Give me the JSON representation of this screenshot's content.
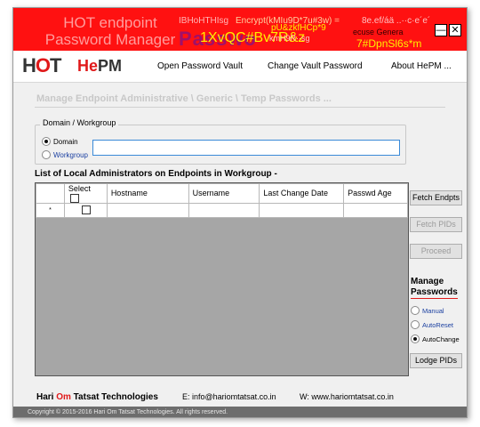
{
  "title": {
    "line1": "HOT endpoint",
    "line2": "Password Manager",
    "deco": [
      "IBHoHTHIsg",
      "Encrypt(kMIu9D*7u#3w) =",
      "8e.ef/áä ..··c·e´e´",
      "Passwo",
      "1XvQC#Bv7R&z",
      "pU&zkfHCp*9",
      "kmH9R··sg",
      "ecuse Genera",
      "7#DpnSl6s*m"
    ],
    "minimize": "—",
    "close": "✕"
  },
  "brand": {
    "logo_h": "H",
    "logo_o": "O",
    "logo_t": "T",
    "product_h": "He",
    "product_rest": "PM"
  },
  "menu": {
    "items": [
      "Open Password Vault",
      "Change Vault Password",
      "About HePM ..."
    ]
  },
  "subtitle": "Manage Endpoint Administrative \\ Generic \\ Temp Passwords ...",
  "domain_group": {
    "legend": "Domain / Workgroup",
    "options": [
      "Domain",
      "Workgroup"
    ],
    "selected": "Domain",
    "input_value": ""
  },
  "list": {
    "title": "List of Local Administrators on Endpoints in Workgroup -",
    "columns": [
      "Select",
      "Hostname",
      "Username",
      "Last Change Date",
      "Passwd Age"
    ],
    "row_marker": "*"
  },
  "buttons": {
    "fetch_endpts": "Fetch Endpts",
    "fetch_pids": "Fetch PIDs",
    "proceed": "Proceed",
    "lodge_pids": "Lodge PIDs"
  },
  "manage": {
    "title_line1": "Manage",
    "title_line2": "Passwords",
    "options": [
      "Manual",
      "AutoReset",
      "AutoChange"
    ],
    "selected": "AutoChange"
  },
  "footer": {
    "company_a": "Hari ",
    "company_om": "Om",
    "company_b": " Tatsat Technologies",
    "email": "E:   info@hariomtatsat.co.in",
    "web": "W:   www.hariomtatsat.co.in",
    "copyright": "Copyright © 2015-2016 Hari Om Tatsat Technologies. All rights reserved."
  },
  "colors": {
    "titlebar": "#ff1111",
    "accent_red": "#e0191a",
    "grid_empty": "#a6a6a6",
    "footer_bar": "#6d6d6d"
  }
}
